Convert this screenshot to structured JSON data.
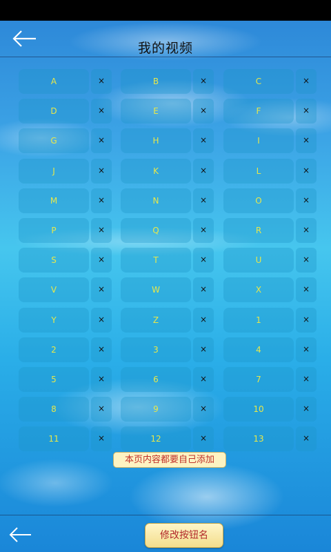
{
  "header": {
    "title": "我的视频"
  },
  "grid": {
    "delete_symbol": "×",
    "rows": [
      [
        "A",
        "B",
        "C"
      ],
      [
        "D",
        "E",
        "F"
      ],
      [
        "G",
        "H",
        "I"
      ],
      [
        "J",
        "K",
        "L"
      ],
      [
        "M",
        "N",
        "O"
      ],
      [
        "P",
        "Q",
        "R"
      ],
      [
        "S",
        "T",
        "U"
      ],
      [
        "V",
        "W",
        "X"
      ],
      [
        "Y",
        "Z",
        "1"
      ],
      [
        "2",
        "3",
        "4"
      ],
      [
        "5",
        "6",
        "7"
      ],
      [
        "8",
        "9",
        "10"
      ],
      [
        "11",
        "12",
        "13"
      ]
    ]
  },
  "note": "本页内容都要自己添加",
  "footer": {
    "rename_label": "修改按钮名"
  },
  "colors": {
    "label_yellow": "#e8e84a",
    "note_red": "#c0302a"
  },
  "icons": {
    "back": "back-arrow-icon",
    "delete": "close-icon"
  }
}
